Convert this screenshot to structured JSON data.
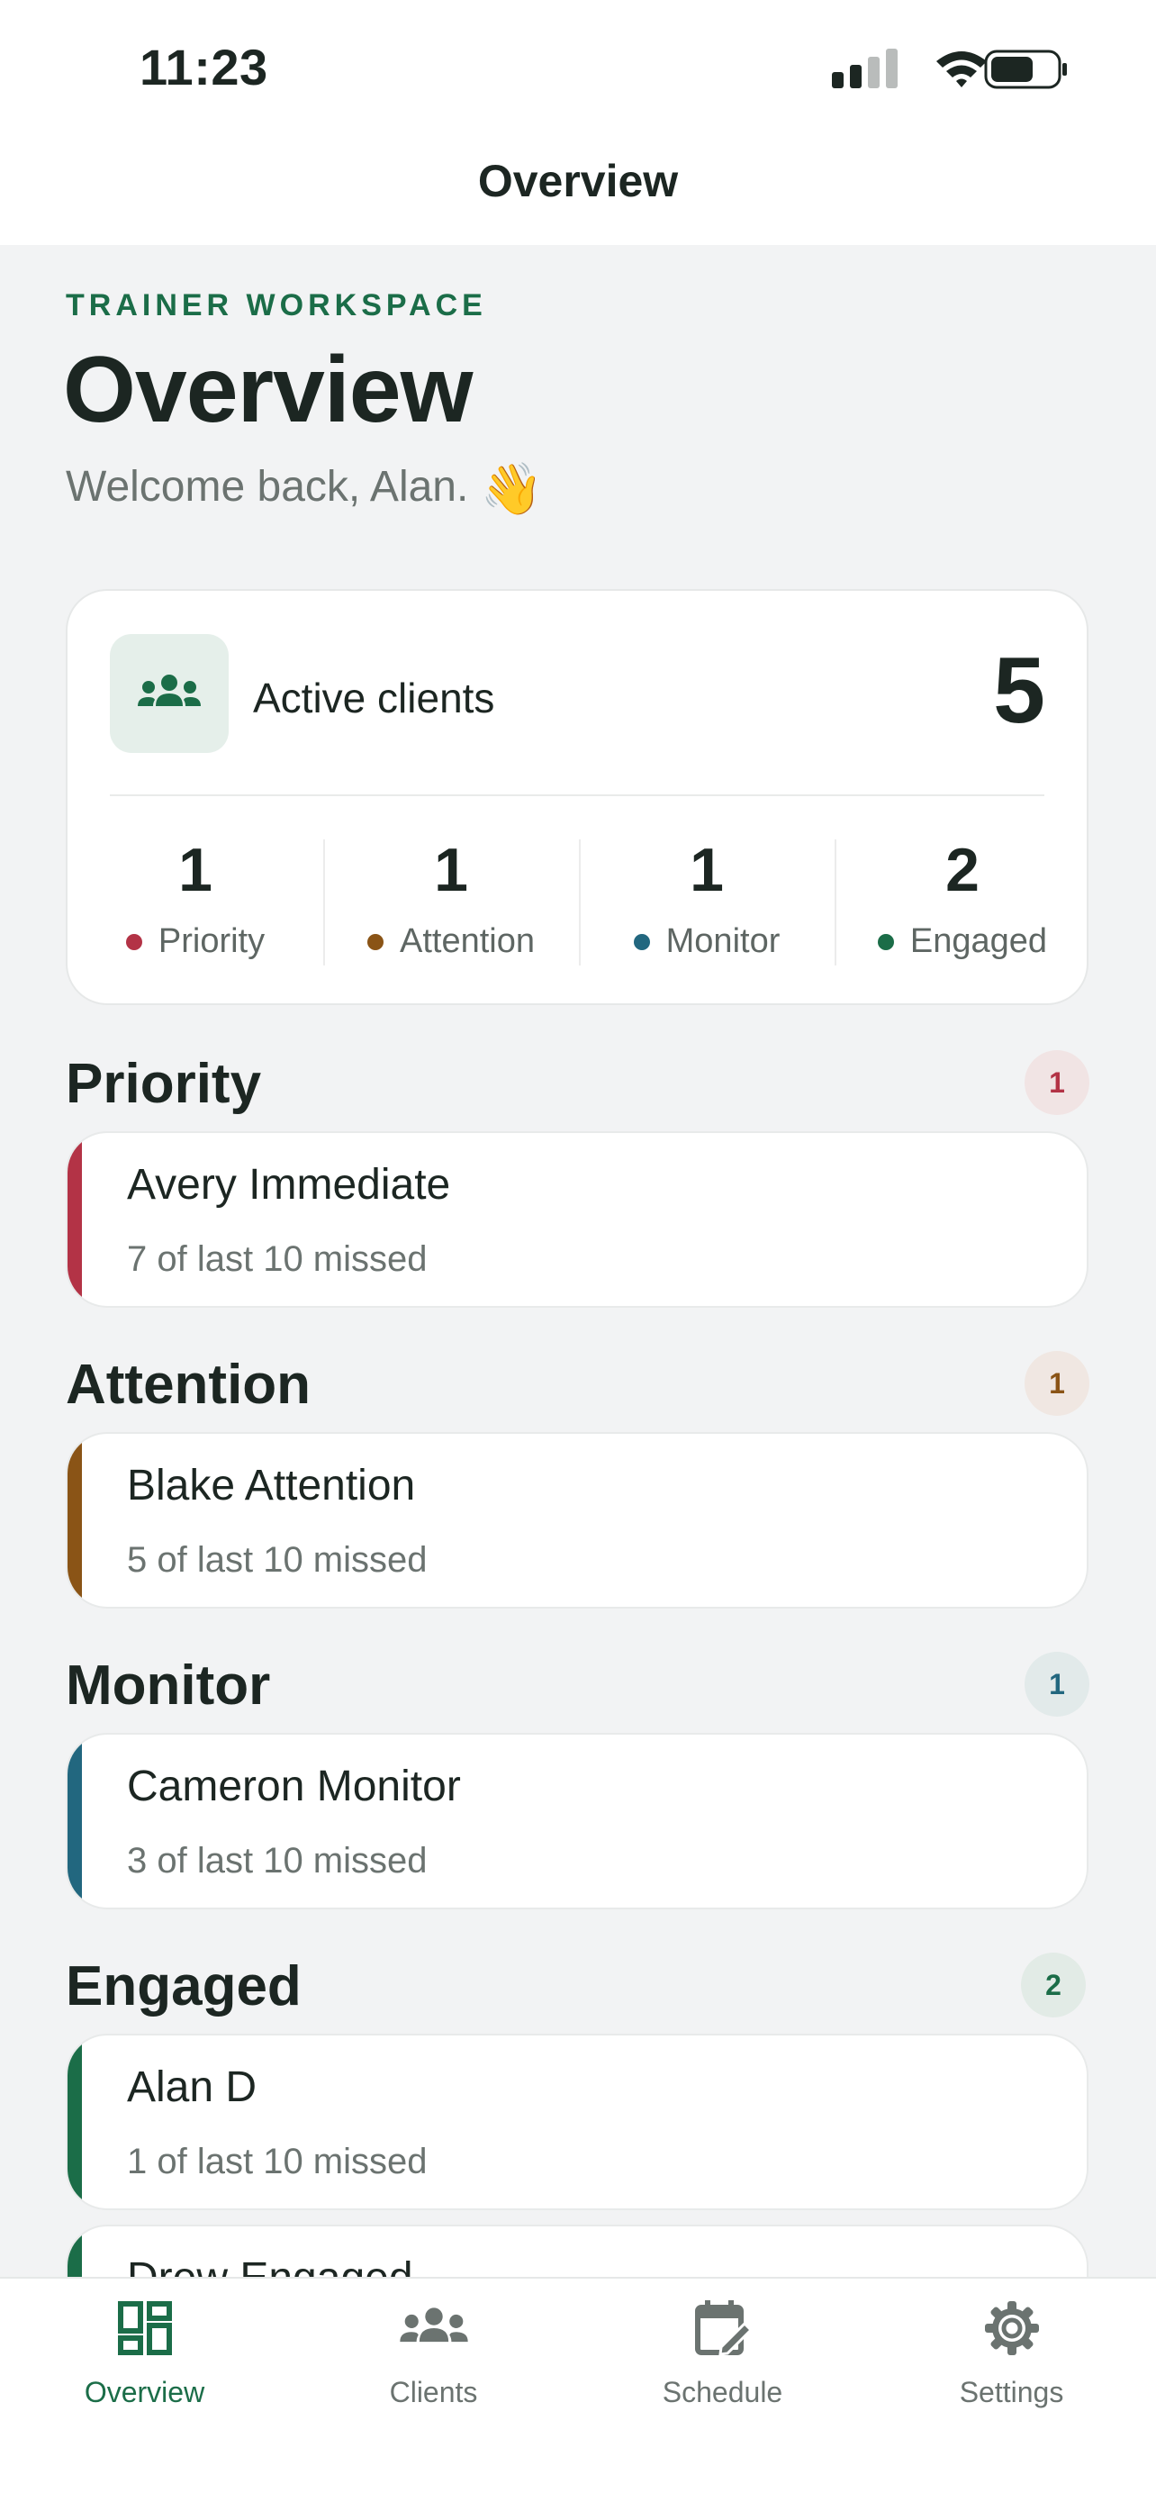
{
  "status_bar": {
    "time": "11:23"
  },
  "nav": {
    "title": "Overview"
  },
  "header": {
    "eyebrow": "TRAINER WORKSPACE",
    "title": "Overview",
    "welcome": "Welcome back, Alan.",
    "welcome_emoji": "👋"
  },
  "summary": {
    "icon": "people-group-icon",
    "label": "Active clients",
    "count": "5",
    "stats": [
      {
        "value": "1",
        "label": "Priority",
        "color": "#b33346"
      },
      {
        "value": "1",
        "label": "Attention",
        "color": "#8a5416"
      },
      {
        "value": "1",
        "label": "Monitor",
        "color": "#22677f"
      },
      {
        "value": "2",
        "label": "Engaged",
        "color": "#1b6d48"
      }
    ]
  },
  "sections": [
    {
      "title": "Priority",
      "count": "1",
      "color": "#b33346",
      "badge_bg": "#f1e4e4",
      "clients": [
        {
          "name": "Avery Immediate",
          "missed": "7 of last 10 missed"
        }
      ]
    },
    {
      "title": "Attention",
      "count": "1",
      "color": "#8a5416",
      "badge_bg": "#f0e7e2",
      "clients": [
        {
          "name": "Blake Attention",
          "missed": "5 of last 10 missed"
        }
      ]
    },
    {
      "title": "Monitor",
      "count": "1",
      "color": "#22677f",
      "badge_bg": "#e2eaea",
      "clients": [
        {
          "name": "Cameron Monitor",
          "missed": "3 of last 10 missed"
        }
      ]
    },
    {
      "title": "Engaged",
      "count": "2",
      "color": "#1b6d48",
      "badge_bg": "#e2ebe6",
      "clients": [
        {
          "name": "Alan D",
          "missed": "1 of last 10 missed"
        },
        {
          "name": "Drew Engaged",
          "missed": ""
        }
      ]
    }
  ],
  "tabbar": {
    "tabs": [
      {
        "label": "Overview",
        "icon": "dashboard-icon",
        "active": true
      },
      {
        "label": "Clients",
        "icon": "people-icon",
        "active": false
      },
      {
        "label": "Schedule",
        "icon": "calendar-edit-icon",
        "active": false
      },
      {
        "label": "Settings",
        "icon": "gear-icon",
        "active": false
      }
    ],
    "active_color": "#1b6d48",
    "inactive_color": "#6b7370"
  }
}
